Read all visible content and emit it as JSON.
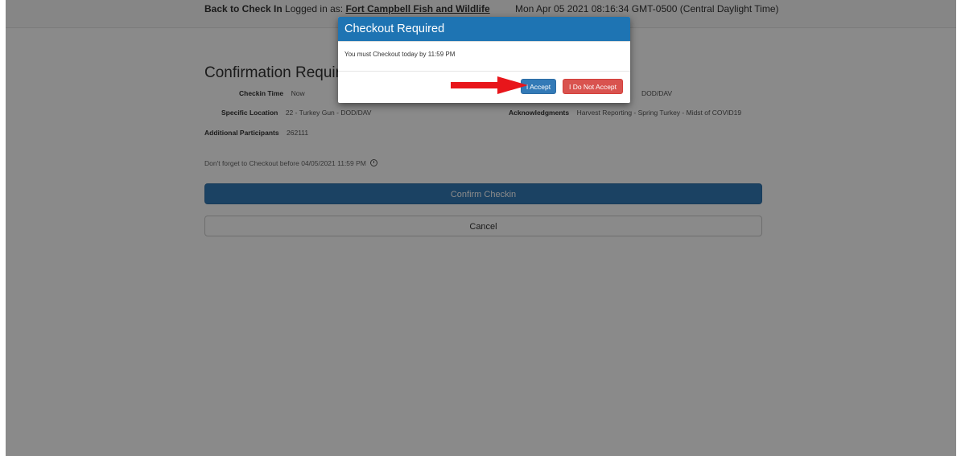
{
  "header": {
    "back_link": "Back to Check In",
    "logged_in_prefix": "Logged in as:",
    "user_name": "Fort Campbell Fish and Wildlife",
    "datetime": "Mon Apr 05 2021 08:16:34 GMT-0500 (Central Daylight Time)"
  },
  "main": {
    "title": "Confirmation Required",
    "checkin_time_label": "Checkin Time",
    "checkin_time_value": "Now",
    "partial_right_value": "DOD/DAV",
    "specific_location_label": "Specific Location",
    "specific_location_value": "22 - Turkey Gun - DOD/DAV",
    "acknowledgments_label": "Acknowledgments",
    "acknowledgments_value": "Harvest Reporting - Spring Turkey - Midst of COVID19",
    "additional_participants_label": "Additional Participants",
    "additional_participants_value": "262111",
    "reminder_text": "Don't forget to Checkout before 04/05/2021 11:59 PM",
    "confirm_button": "Confirm Checkin",
    "cancel_button": "Cancel"
  },
  "modal": {
    "title": "Checkout Required",
    "body": "You must Checkout today by 11:59 PM",
    "accept_button": "I Accept",
    "decline_button": "I Do Not Accept"
  },
  "colors": {
    "primary": "#337ab7",
    "modal_header": "#1e74b3",
    "danger": "#d9534f",
    "annotation_arrow": "#e8161b"
  },
  "icons": [
    "clock-icon",
    "arrow-annotation-icon"
  ]
}
